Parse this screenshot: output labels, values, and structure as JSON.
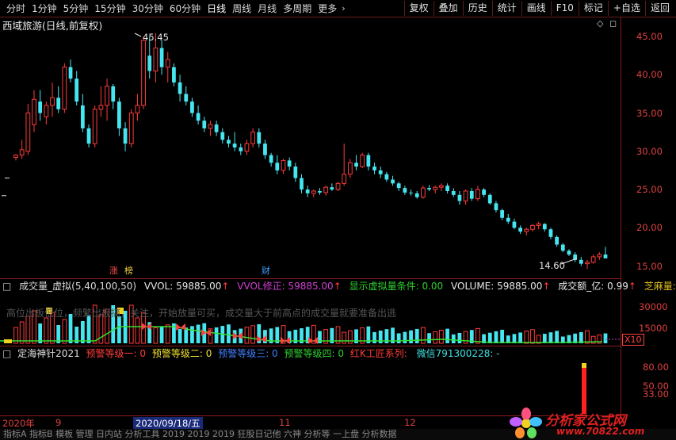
{
  "toolbar": {
    "left": [
      {
        "label": "分时"
      },
      {
        "label": "1分钟"
      },
      {
        "label": "5分钟"
      },
      {
        "label": "15分钟"
      },
      {
        "label": "30分钟"
      },
      {
        "label": "60分钟"
      },
      {
        "label": "日线",
        "selected": true
      },
      {
        "label": "周线"
      },
      {
        "label": "月线"
      },
      {
        "label": "多周期"
      },
      {
        "label": "更多"
      }
    ],
    "more_arrow": "›",
    "right": [
      {
        "label": "复权"
      },
      {
        "label": "叠加"
      },
      {
        "label": "历史"
      },
      {
        "label": "统计"
      },
      {
        "label": "画线"
      },
      {
        "label": "F10"
      },
      {
        "label": "标记"
      },
      {
        "label": "+自选"
      },
      {
        "label": "返回"
      }
    ]
  },
  "chart": {
    "title": "西域旅游(日线,前复权)",
    "high_label": "45.45",
    "low_label": "14.60",
    "event_labels": {
      "zhang": "涨",
      "bang": "榜",
      "cai": "财"
    },
    "yticks": [
      "45.00",
      "40.00",
      "35.00",
      "30.00",
      "25.00",
      "20.00",
      "15.00"
    ]
  },
  "volume_panel": {
    "name": "成交量_虚拟(5,40,100,50)",
    "vvol": "VVOL: 59885.00",
    "vvol_fix": "VVOL修正: 59885.00",
    "cond": "显示虚拟量条件: 0.00",
    "volume": "VOLUME: 59885.00",
    "amount": "成交额_亿: 0.99",
    "extra": "芝麻量:",
    "notice": "高位出板低位，频繁出板搞，关注，开始放量可买，成交量大于前高点的成交量就要准备出逃",
    "yticks": [
      "30000",
      "15000"
    ],
    "unit": "X10"
  },
  "indicator_panel": {
    "name": "定海神针2021",
    "w1": "预警等级一: 0",
    "w2": "预警等级二: 0",
    "w3": "预警等级三: 0",
    "w4": "预警等级四: 0",
    "red_k": "红K工匠系列",
    "wechat": "微信791300228: -",
    "yticks": [
      "80.00",
      "50.00",
      "33.00"
    ]
  },
  "time_axis": {
    "labels": [
      {
        "text": "2020年"
      },
      {
        "text": "9"
      },
      {
        "text": "2020/09/18/五"
      },
      {
        "text": "11"
      },
      {
        "text": "12"
      }
    ]
  },
  "bottom_text": "指标A 指标B 模板 管理 日内站 分析工具 2019 2019 2019 狂股日记他 六神 分析等 一上盘 分析数据",
  "logo": {
    "text": "分析家公式网",
    "url": "www.70822.com"
  },
  "colors": {
    "up": "#ff3b3b",
    "down": "#46e6f0",
    "axis": "#e04040",
    "bg": "#000000"
  },
  "chart_data": {
    "type": "candlestick",
    "ylim": [
      13.5,
      47.5
    ],
    "candles": [
      [
        29.2,
        29.6,
        28.8,
        29.5
      ],
      [
        29.5,
        31.5,
        29.0,
        30.2
      ],
      [
        30.0,
        36.2,
        29.5,
        35.0
      ],
      [
        33.5,
        38.0,
        32.5,
        36.8
      ],
      [
        36.5,
        38.0,
        34.0,
        35.0
      ],
      [
        34.5,
        36.5,
        33.5,
        36.0
      ],
      [
        36.0,
        39.0,
        34.5,
        37.0
      ],
      [
        37.0,
        38.5,
        35.0,
        35.5
      ],
      [
        35.5,
        41.5,
        35.0,
        41.0
      ],
      [
        41.0,
        42.0,
        39.0,
        39.5
      ],
      [
        39.5,
        40.5,
        36.0,
        36.5
      ],
      [
        36.0,
        37.5,
        32.5,
        33.0
      ],
      [
        33.0,
        33.5,
        30.5,
        31.0
      ],
      [
        31.0,
        36.0,
        30.5,
        35.5
      ],
      [
        35.5,
        38.5,
        34.5,
        36.0
      ],
      [
        36.0,
        39.5,
        34.0,
        38.5
      ],
      [
        38.5,
        38.8,
        35.5,
        36.5
      ],
      [
        36.5,
        37.0,
        32.0,
        33.0
      ],
      [
        33.0,
        33.8,
        30.0,
        31.0
      ],
      [
        31.0,
        35.5,
        30.5,
        35.0
      ],
      [
        35.0,
        37.5,
        34.0,
        36.0
      ],
      [
        36.0,
        45.0,
        35.5,
        44.5
      ],
      [
        42.5,
        45.0,
        39.5,
        40.5
      ],
      [
        40.5,
        45.45,
        39.0,
        43.5
      ],
      [
        43.5,
        44.5,
        40.0,
        41.0
      ],
      [
        41.0,
        43.0,
        39.0,
        42.0
      ],
      [
        41.0,
        41.5,
        38.5,
        39.0
      ],
      [
        39.0,
        40.0,
        36.5,
        37.5
      ],
      [
        37.5,
        38.5,
        36.0,
        36.5
      ],
      [
        36.5,
        37.0,
        34.5,
        35.0
      ],
      [
        35.0,
        36.0,
        33.5,
        34.0
      ],
      [
        34.0,
        34.5,
        32.5,
        33.0
      ],
      [
        33.0,
        34.0,
        32.0,
        33.5
      ],
      [
        33.5,
        34.0,
        32.0,
        32.5
      ],
      [
        32.5,
        33.0,
        31.0,
        31.5
      ],
      [
        31.5,
        32.0,
        30.5,
        31.0
      ],
      [
        31.0,
        32.5,
        30.0,
        30.5
      ],
      [
        30.5,
        31.0,
        29.5,
        30.0
      ],
      [
        30.0,
        31.5,
        29.5,
        31.0
      ],
      [
        31.0,
        33.0,
        30.5,
        32.5
      ],
      [
        32.5,
        33.0,
        30.5,
        31.0
      ],
      [
        31.0,
        31.5,
        29.0,
        29.5
      ],
      [
        29.5,
        29.8,
        28.0,
        28.5
      ],
      [
        28.5,
        29.5,
        27.0,
        27.5
      ],
      [
        27.5,
        29.0,
        27.0,
        28.8
      ],
      [
        28.8,
        29.2,
        27.5,
        28.0
      ],
      [
        28.0,
        28.5,
        26.0,
        26.5
      ],
      [
        26.5,
        27.0,
        24.5,
        25.0
      ],
      [
        25.0,
        25.5,
        24.0,
        24.5
      ],
      [
        24.5,
        25.0,
        24.0,
        24.8
      ],
      [
        24.8,
        25.2,
        24.3,
        24.6
      ],
      [
        24.6,
        25.5,
        24.2,
        25.3
      ],
      [
        25.3,
        25.8,
        24.8,
        25.0
      ],
      [
        25.0,
        26.0,
        24.8,
        25.8
      ],
      [
        25.8,
        31.0,
        25.5,
        27.0
      ],
      [
        27.0,
        29.0,
        26.5,
        28.5
      ],
      [
        28.5,
        29.5,
        27.5,
        28.0
      ],
      [
        28.0,
        29.8,
        27.8,
        29.5
      ],
      [
        29.5,
        29.8,
        27.5,
        28.0
      ],
      [
        28.0,
        28.5,
        27.0,
        27.5
      ],
      [
        27.5,
        28.0,
        26.5,
        27.0
      ],
      [
        27.0,
        27.3,
        26.0,
        26.3
      ],
      [
        26.3,
        26.8,
        25.5,
        25.8
      ],
      [
        25.8,
        26.0,
        24.8,
        25.2
      ],
      [
        25.2,
        25.5,
        24.3,
        24.6
      ],
      [
        24.6,
        25.0,
        24.2,
        24.5
      ],
      [
        24.5,
        24.8,
        23.8,
        24.0
      ],
      [
        24.0,
        25.5,
        23.8,
        25.2
      ],
      [
        25.2,
        25.6,
        24.8,
        25.0
      ],
      [
        25.0,
        25.5,
        24.5,
        25.3
      ],
      [
        25.3,
        25.8,
        24.8,
        25.5
      ],
      [
        25.5,
        25.8,
        24.5,
        24.8
      ],
      [
        24.8,
        25.2,
        24.0,
        24.3
      ],
      [
        24.3,
        24.8,
        23.0,
        23.5
      ],
      [
        23.5,
        25.0,
        23.0,
        24.8
      ],
      [
        24.8,
        25.2,
        23.5,
        23.8
      ],
      [
        23.8,
        25.5,
        23.5,
        25.0
      ],
      [
        25.0,
        25.2,
        24.0,
        24.3
      ],
      [
        24.3,
        24.5,
        23.0,
        23.2
      ],
      [
        23.2,
        23.5,
        22.0,
        22.3
      ],
      [
        22.3,
        22.5,
        21.0,
        21.3
      ],
      [
        21.3,
        21.8,
        20.5,
        20.8
      ],
      [
        20.8,
        21.2,
        19.8,
        20.0
      ],
      [
        20.0,
        20.3,
        19.2,
        19.5
      ],
      [
        19.5,
        20.0,
        19.0,
        19.8
      ],
      [
        19.8,
        20.5,
        19.5,
        20.3
      ],
      [
        20.3,
        20.8,
        19.8,
        20.5
      ],
      [
        20.5,
        20.6,
        19.5,
        19.8
      ],
      [
        19.8,
        20.0,
        18.5,
        18.8
      ],
      [
        18.8,
        19.0,
        17.5,
        17.8
      ],
      [
        17.8,
        18.0,
        16.8,
        17.0
      ],
      [
        17.0,
        17.2,
        16.3,
        16.5
      ],
      [
        16.5,
        16.8,
        15.5,
        15.8
      ],
      [
        15.8,
        16.2,
        15.0,
        15.3
      ],
      [
        15.3,
        15.8,
        14.6,
        15.5
      ],
      [
        15.5,
        16.5,
        15.3,
        16.2
      ],
      [
        16.2,
        16.8,
        15.8,
        16.5
      ],
      [
        16.5,
        17.5,
        16.0,
        16.0
      ]
    ]
  }
}
